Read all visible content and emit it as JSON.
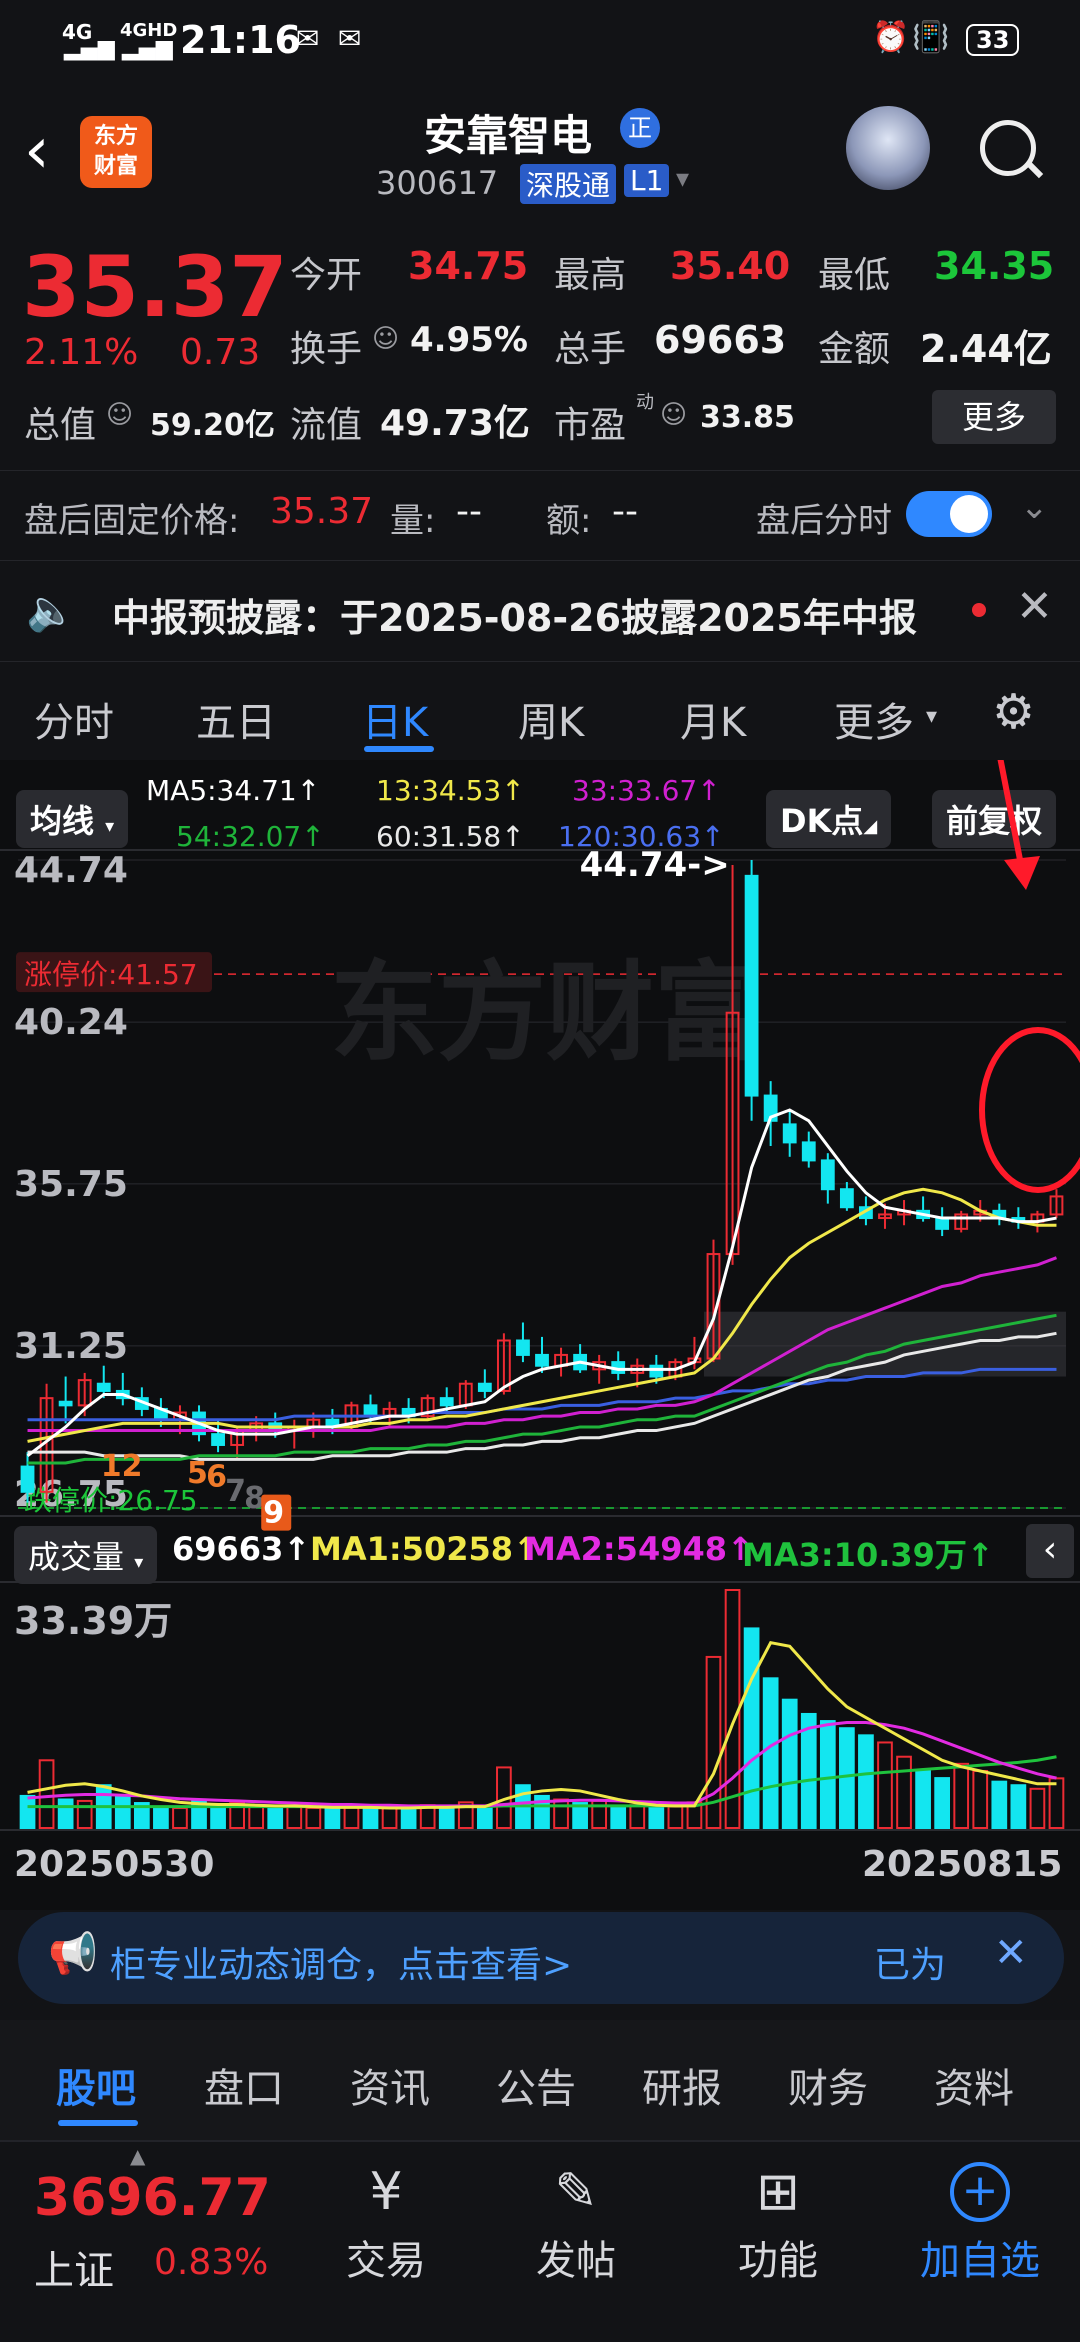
{
  "status_bar": {
    "signal1": "4G",
    "signal2": "4GHD",
    "time": "21:16",
    "battery": "33"
  },
  "header": {
    "logo_line1": "东方",
    "logo_line2": "财富",
    "stock_name": "安靠智电",
    "badge": "正",
    "code": "300617",
    "exchange_tag": "深股通",
    "level_tag": "L1"
  },
  "quote": {
    "price": "35.37",
    "change_pct": "2.11%",
    "change": "0.73",
    "open_label": "今开",
    "open": "34.75",
    "high_label": "最高",
    "high": "35.40",
    "low_label": "最低",
    "low": "34.35",
    "turnover_label": "换手",
    "turnover": "4.95%",
    "volume_label": "总手",
    "volume": "69663",
    "amount_label": "金额",
    "amount": "2.44亿",
    "mcap_label": "总值",
    "mcap": "59.20亿",
    "float_label": "流值",
    "float": "49.73亿",
    "pe_label": "市盈",
    "pe_sup": "动",
    "pe": "33.85",
    "more_button": "更多"
  },
  "after_hours": {
    "label": "盘后固定价格:",
    "price": "35.37",
    "vol_label": "量:",
    "vol": "--",
    "amt_label": "额:",
    "amt": "--",
    "toggle_label": "盘后分时",
    "toggle_on": true
  },
  "notice": {
    "text": "中报预披露：于2025-08-26披露2025年中报"
  },
  "period_tabs": [
    "分时",
    "五日",
    "日K",
    "周K",
    "月K",
    "更多"
  ],
  "active_tab": "日K",
  "chart": {
    "ma_button": "均线",
    "ma5": "MA5:34.71↑",
    "ma13": "13:34.53↑",
    "ma33": "33:33.67↑",
    "ma54": "54:32.07↑",
    "ma60": "60:31.58↑",
    "ma120": "120:30.63↑",
    "dk_button": "DK点",
    "fq_button": "前复权",
    "y_labels": [
      "44.74",
      "40.24",
      "35.75",
      "31.25",
      "26.75"
    ],
    "high_marker": "44.74->",
    "limit_up": "涨停价:41.57",
    "limit_down": "跌停价:26.75",
    "watermark": "东方财富",
    "vol_button": "成交量",
    "vol_value": "69663↑",
    "vol_ma1": "MA1:50258↑",
    "vol_ma2": "MA2:54948↑",
    "vol_ma3": "MA3:10.39万↑",
    "vol_max": "33.39万",
    "date_start": "20250530",
    "date_end": "20250815",
    "badges": [
      "12",
      "5",
      "6",
      "7",
      "8",
      "9"
    ]
  },
  "chart_data": {
    "type": "candlestick",
    "ylim": [
      26.75,
      44.74
    ],
    "candles": [
      {
        "o": 27.9,
        "h": 28.3,
        "l": 26.9,
        "c": 27.2
      },
      {
        "o": 27.2,
        "h": 30.2,
        "l": 26.9,
        "c": 29.8
      },
      {
        "o": 29.7,
        "h": 30.4,
        "l": 29.1,
        "c": 29.6
      },
      {
        "o": 29.6,
        "h": 30.5,
        "l": 29.3,
        "c": 30.3
      },
      {
        "o": 30.2,
        "h": 30.7,
        "l": 29.8,
        "c": 30.0
      },
      {
        "o": 30.0,
        "h": 30.5,
        "l": 29.6,
        "c": 29.8
      },
      {
        "o": 29.8,
        "h": 30.1,
        "l": 29.3,
        "c": 29.5
      },
      {
        "o": 29.5,
        "h": 29.8,
        "l": 29.0,
        "c": 29.2
      },
      {
        "o": 29.2,
        "h": 29.6,
        "l": 28.8,
        "c": 29.4
      },
      {
        "o": 29.4,
        "h": 29.6,
        "l": 28.6,
        "c": 28.8
      },
      {
        "o": 28.8,
        "h": 29.2,
        "l": 28.3,
        "c": 28.5
      },
      {
        "o": 28.5,
        "h": 29.0,
        "l": 28.1,
        "c": 28.9
      },
      {
        "o": 28.9,
        "h": 29.3,
        "l": 28.6,
        "c": 29.1
      },
      {
        "o": 29.1,
        "h": 29.4,
        "l": 28.7,
        "c": 28.9
      },
      {
        "o": 28.9,
        "h": 29.2,
        "l": 28.4,
        "c": 29.0
      },
      {
        "o": 29.0,
        "h": 29.4,
        "l": 28.7,
        "c": 29.2
      },
      {
        "o": 29.2,
        "h": 29.5,
        "l": 28.8,
        "c": 29.0
      },
      {
        "o": 29.0,
        "h": 29.7,
        "l": 28.9,
        "c": 29.6
      },
      {
        "o": 29.6,
        "h": 29.9,
        "l": 29.1,
        "c": 29.3
      },
      {
        "o": 29.3,
        "h": 29.7,
        "l": 29.0,
        "c": 29.5
      },
      {
        "o": 29.5,
        "h": 29.8,
        "l": 29.1,
        "c": 29.3
      },
      {
        "o": 29.3,
        "h": 29.9,
        "l": 29.2,
        "c": 29.8
      },
      {
        "o": 29.8,
        "h": 30.1,
        "l": 29.4,
        "c": 29.6
      },
      {
        "o": 29.6,
        "h": 30.3,
        "l": 29.5,
        "c": 30.2
      },
      {
        "o": 30.2,
        "h": 30.6,
        "l": 29.8,
        "c": 30.0
      },
      {
        "o": 30.0,
        "h": 31.6,
        "l": 29.9,
        "c": 31.4
      },
      {
        "o": 31.4,
        "h": 31.9,
        "l": 30.8,
        "c": 31.0
      },
      {
        "o": 31.0,
        "h": 31.5,
        "l": 30.5,
        "c": 30.7
      },
      {
        "o": 30.7,
        "h": 31.2,
        "l": 30.4,
        "c": 31.0
      },
      {
        "o": 31.0,
        "h": 31.3,
        "l": 30.5,
        "c": 30.6
      },
      {
        "o": 30.6,
        "h": 31.0,
        "l": 30.2,
        "c": 30.8
      },
      {
        "o": 30.8,
        "h": 31.1,
        "l": 30.3,
        "c": 30.5
      },
      {
        "o": 30.5,
        "h": 30.9,
        "l": 30.1,
        "c": 30.7
      },
      {
        "o": 30.7,
        "h": 31.0,
        "l": 30.2,
        "c": 30.4
      },
      {
        "o": 30.4,
        "h": 30.9,
        "l": 30.3,
        "c": 30.8
      },
      {
        "o": 30.8,
        "h": 31.5,
        "l": 30.6,
        "c": 30.9
      },
      {
        "o": 30.9,
        "h": 34.2,
        "l": 30.8,
        "c": 33.8
      },
      {
        "o": 33.8,
        "h": 44.6,
        "l": 33.5,
        "c": 40.5
      },
      {
        "o": 44.3,
        "h": 44.74,
        "l": 37.5,
        "c": 38.2
      },
      {
        "o": 38.2,
        "h": 38.6,
        "l": 36.8,
        "c": 37.5
      },
      {
        "o": 37.4,
        "h": 37.8,
        "l": 36.5,
        "c": 36.9
      },
      {
        "o": 36.9,
        "h": 37.2,
        "l": 36.2,
        "c": 36.4
      },
      {
        "o": 36.4,
        "h": 36.6,
        "l": 35.2,
        "c": 35.6
      },
      {
        "o": 35.6,
        "h": 35.8,
        "l": 35.0,
        "c": 35.1
      },
      {
        "o": 35.1,
        "h": 35.4,
        "l": 34.6,
        "c": 34.8
      },
      {
        "o": 34.8,
        "h": 35.2,
        "l": 34.5,
        "c": 34.9
      },
      {
        "o": 34.9,
        "h": 35.3,
        "l": 34.6,
        "c": 35.0
      },
      {
        "o": 35.0,
        "h": 35.4,
        "l": 34.7,
        "c": 34.8
      },
      {
        "o": 34.8,
        "h": 35.1,
        "l": 34.3,
        "c": 34.5
      },
      {
        "o": 34.5,
        "h": 35.0,
        "l": 34.4,
        "c": 34.9
      },
      {
        "o": 34.9,
        "h": 35.3,
        "l": 34.7,
        "c": 35.0
      },
      {
        "o": 35.0,
        "h": 35.2,
        "l": 34.6,
        "c": 34.8
      },
      {
        "o": 34.8,
        "h": 35.1,
        "l": 34.5,
        "c": 34.7
      },
      {
        "o": 34.7,
        "h": 35.0,
        "l": 34.4,
        "c": 34.9
      },
      {
        "o": 34.9,
        "h": 35.6,
        "l": 34.8,
        "c": 35.4
      }
    ],
    "ma5": [
      28.2,
      28.6,
      29.0,
      29.5,
      29.9,
      29.9,
      29.7,
      29.5,
      29.3,
      29.1,
      28.9,
      28.8,
      28.8,
      28.8,
      28.9,
      29.0,
      29.0,
      29.1,
      29.2,
      29.3,
      29.3,
      29.4,
      29.5,
      29.6,
      29.7,
      30.1,
      30.4,
      30.6,
      30.7,
      30.8,
      30.7,
      30.6,
      30.6,
      30.6,
      30.6,
      30.8,
      32.0,
      34.0,
      36.2,
      37.6,
      37.8,
      37.5,
      36.8,
      36.1,
      35.5,
      35.1,
      35.0,
      34.9,
      34.8,
      34.8,
      34.8,
      34.8,
      34.7,
      34.7,
      34.8
    ],
    "ma13": [
      28.6,
      28.7,
      28.8,
      28.9,
      29.0,
      29.1,
      29.1,
      29.1,
      29.1,
      29.1,
      29.1,
      29.0,
      29.0,
      29.0,
      29.0,
      29.0,
      29.0,
      29.0,
      29.1,
      29.1,
      29.2,
      29.2,
      29.3,
      29.3,
      29.4,
      29.5,
      29.6,
      29.7,
      29.8,
      29.9,
      30.0,
      30.1,
      30.2,
      30.3,
      30.4,
      30.5,
      30.9,
      31.6,
      32.4,
      33.1,
      33.7,
      34.1,
      34.4,
      34.7,
      35.0,
      35.3,
      35.5,
      35.6,
      35.5,
      35.3,
      35.0,
      34.8,
      34.7,
      34.6,
      34.6
    ],
    "ma33": [
      28.9,
      28.9,
      28.9,
      28.9,
      28.9,
      28.9,
      28.9,
      28.9,
      28.9,
      28.9,
      28.9,
      28.9,
      28.9,
      28.9,
      28.9,
      28.9,
      28.9,
      28.9,
      28.9,
      29.0,
      29.0,
      29.0,
      29.0,
      29.1,
      29.1,
      29.2,
      29.2,
      29.3,
      29.3,
      29.4,
      29.4,
      29.5,
      29.5,
      29.6,
      29.6,
      29.7,
      29.9,
      30.2,
      30.5,
      30.8,
      31.1,
      31.4,
      31.7,
      31.9,
      32.1,
      32.3,
      32.5,
      32.7,
      32.9,
      33.0,
      33.2,
      33.3,
      33.4,
      33.5,
      33.7
    ],
    "ma54": [
      28.0,
      28.0,
      28.0,
      28.1,
      28.1,
      28.1,
      28.1,
      28.1,
      28.1,
      28.2,
      28.2,
      28.2,
      28.2,
      28.2,
      28.3,
      28.3,
      28.3,
      28.3,
      28.4,
      28.4,
      28.4,
      28.5,
      28.5,
      28.6,
      28.6,
      28.7,
      28.8,
      28.8,
      28.9,
      29.0,
      29.0,
      29.1,
      29.2,
      29.2,
      29.3,
      29.3,
      29.5,
      29.7,
      29.9,
      30.1,
      30.3,
      30.5,
      30.7,
      30.8,
      31.0,
      31.1,
      31.3,
      31.4,
      31.5,
      31.6,
      31.7,
      31.8,
      31.9,
      32.0,
      32.1
    ],
    "ma60": [
      28.3,
      28.3,
      28.3,
      28.3,
      28.2,
      28.2,
      28.2,
      28.2,
      28.2,
      28.1,
      28.1,
      28.1,
      28.1,
      28.1,
      28.1,
      28.1,
      28.2,
      28.2,
      28.2,
      28.2,
      28.3,
      28.3,
      28.3,
      28.4,
      28.4,
      28.5,
      28.5,
      28.6,
      28.6,
      28.7,
      28.7,
      28.8,
      28.9,
      28.9,
      29.0,
      29.1,
      29.3,
      29.5,
      29.7,
      29.9,
      30.1,
      30.3,
      30.4,
      30.6,
      30.7,
      30.8,
      31.0,
      31.1,
      31.2,
      31.3,
      31.4,
      31.4,
      31.5,
      31.5,
      31.6
    ],
    "ma120": [
      29.2,
      29.2,
      29.2,
      29.2,
      29.2,
      29.2,
      29.2,
      29.2,
      29.2,
      29.2,
      29.2,
      29.2,
      29.2,
      29.2,
      29.3,
      29.3,
      29.3,
      29.3,
      29.3,
      29.3,
      29.3,
      29.4,
      29.4,
      29.4,
      29.4,
      29.5,
      29.5,
      29.5,
      29.6,
      29.6,
      29.6,
      29.7,
      29.7,
      29.7,
      29.8,
      29.8,
      29.9,
      30.0,
      30.0,
      30.1,
      30.2,
      30.2,
      30.3,
      30.3,
      30.4,
      30.4,
      30.4,
      30.5,
      30.5,
      30.5,
      30.6,
      30.6,
      30.6,
      30.6,
      30.6
    ],
    "volume_max": 333900,
    "volumes": [
      45000,
      95000,
      40000,
      38000,
      60000,
      45000,
      35000,
      30000,
      28000,
      40000,
      30000,
      35000,
      32000,
      30000,
      30000,
      28000,
      26000,
      30000,
      28000,
      30000,
      25000,
      32000,
      28000,
      36000,
      30000,
      85000,
      60000,
      45000,
      40000,
      35000,
      38000,
      30000,
      32000,
      28000,
      30000,
      36000,
      240000,
      333900,
      280000,
      210000,
      180000,
      160000,
      150000,
      140000,
      130000,
      120000,
      100000,
      80000,
      70000,
      90000,
      80000,
      65000,
      60000,
      55000,
      69663
    ],
    "vol_ma1": [
      50000,
      55000,
      60000,
      62000,
      58000,
      52000,
      45000,
      40000,
      36000,
      34000,
      33000,
      33000,
      32000,
      31000,
      31000,
      30000,
      29000,
      29000,
      29000,
      28000,
      28000,
      29000,
      29000,
      30000,
      30000,
      40000,
      48000,
      52000,
      54000,
      52000,
      46000,
      40000,
      35000,
      32000,
      31000,
      31000,
      76000,
      146000,
      209000,
      260000,
      255000,
      225000,
      195000,
      170000,
      155000,
      140000,
      125000,
      110000,
      95000,
      86000,
      80000,
      74000,
      68000,
      62000,
      62000
    ],
    "vol_ma2": [
      42000,
      44000,
      46000,
      47000,
      47000,
      46000,
      45000,
      43000,
      41000,
      40000,
      39000,
      38000,
      37000,
      36000,
      35000,
      34000,
      33000,
      33000,
      32000,
      32000,
      31000,
      31000,
      31000,
      31000,
      31000,
      33000,
      35000,
      37000,
      38000,
      39000,
      39000,
      38000,
      37000,
      36000,
      35000,
      35000,
      48000,
      70000,
      95000,
      115000,
      130000,
      140000,
      145000,
      148000,
      148000,
      145000,
      140000,
      132000,
      122000,
      112000,
      102000,
      92000,
      84000,
      76000,
      70000
    ],
    "vol_ma3": [
      30000,
      30000,
      30000,
      30000,
      30000,
      30000,
      30000,
      30000,
      30000,
      30000,
      30000,
      30000,
      30000,
      30000,
      30000,
      30000,
      30000,
      30000,
      30000,
      30000,
      30000,
      30000,
      30000,
      30000,
      30000,
      31000,
      31000,
      31000,
      31000,
      31000,
      31000,
      31000,
      31000,
      31000,
      31000,
      31000,
      36000,
      44000,
      52000,
      58000,
      63000,
      67000,
      70000,
      73000,
      76000,
      78000,
      80000,
      82000,
      84000,
      86000,
      88000,
      90000,
      92000,
      95000,
      100000
    ]
  },
  "banner": {
    "text": "柜专业动态调仓，点击查看>",
    "right_text": "已为"
  },
  "bottom_tabs": [
    "股吧",
    "盘口",
    "资讯",
    "公告",
    "研报",
    "财务",
    "资料"
  ],
  "active_bottom_tab": "股吧",
  "dock": {
    "index_value": "3696.77",
    "index_name": "上证",
    "index_change": "0.83%",
    "trade": "交易",
    "post": "发帖",
    "features": "功能",
    "add_watch": "加自选"
  },
  "colors": {
    "up": "#ec2b33",
    "down": "#1cc63a",
    "cyan": "#13e6f0",
    "accent_blue": "#2f88ff",
    "ma5": "#ffffff",
    "ma13": "#f0e84a",
    "ma33": "#d020d0",
    "ma54": "#1fb43a",
    "ma60": "#e8e8e8",
    "ma120": "#3a5fe0"
  }
}
